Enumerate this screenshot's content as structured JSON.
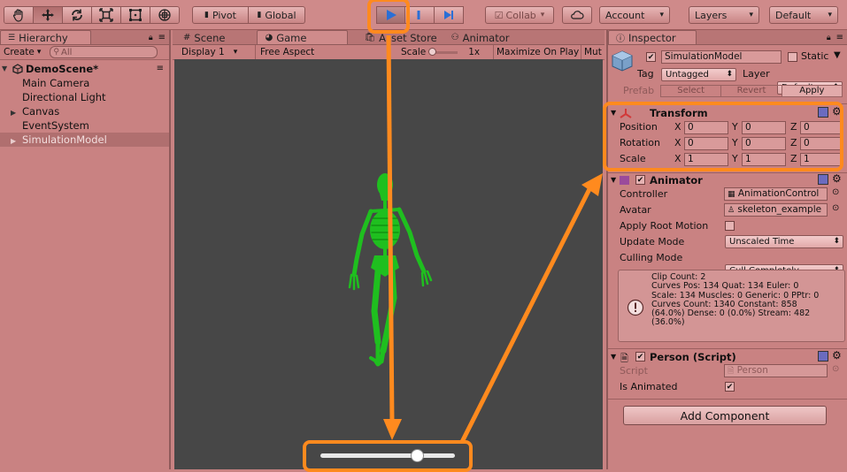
{
  "toolbar": {
    "pivot_label": "Pivot",
    "global_label": "Global",
    "collab_label": "Collab",
    "account_label": "Account",
    "layers_label": "Layers",
    "layout_label": "Default"
  },
  "hierarchy": {
    "tab_label": "Hierarchy",
    "create_label": "Create",
    "search_placeholder": "All",
    "scene_name": "DemoScene*",
    "items": [
      {
        "label": "Main Camera"
      },
      {
        "label": "Directional Light"
      },
      {
        "label": "Canvas"
      },
      {
        "label": "EventSystem"
      },
      {
        "label": "SimulationModel"
      }
    ]
  },
  "center": {
    "tabs": [
      {
        "label": "Scene"
      },
      {
        "label": "Game"
      },
      {
        "label": "Asset Store"
      },
      {
        "label": "Animator"
      }
    ],
    "display_label": "Display 1",
    "aspect_label": "Free Aspect",
    "scale_label": "Scale",
    "scale_value": "1x",
    "maximize_label": "Maximize On Play",
    "mute_label": "Mut",
    "slider_value": 0.72
  },
  "inspector": {
    "tab_label": "Inspector",
    "object_name": "SimulationModel",
    "static_label": "Static",
    "tag_label": "Tag",
    "tag_value": "Untagged",
    "layer_label": "Layer",
    "layer_value": "Default",
    "prefab_label": "Prefab",
    "select_label": "Select",
    "revert_label": "Revert",
    "apply_label": "Apply",
    "transform": {
      "title": "Transform",
      "position_label": "Position",
      "rotation_label": "Rotation",
      "scale_label": "Scale",
      "x": "X",
      "y": "Y",
      "z": "Z",
      "position": [
        "0",
        "0",
        "0"
      ],
      "rotation": [
        "0",
        "0",
        "0"
      ],
      "scale": [
        "1",
        "1",
        "1"
      ]
    },
    "animator": {
      "title": "Animator",
      "controller_label": "Controller",
      "controller_value": "AnimationControl",
      "avatar_label": "Avatar",
      "avatar_value": "skeleton_example",
      "apply_root_motion_label": "Apply Root Motion",
      "update_mode_label": "Update Mode",
      "update_mode_value": "Unscaled Time",
      "culling_mode_label": "Culling Mode",
      "culling_mode_value": "Cull Completely",
      "info_lines": [
        "Clip Count: 2",
        "Curves Pos: 134 Quat: 134 Euler: 0",
        "Scale: 134 Muscles: 0 Generic: 0 PPtr: 0",
        "Curves Count: 1340 Constant: 858",
        "(64.0%) Dense: 0 (0.0%) Stream: 482",
        "(36.0%)"
      ]
    },
    "person": {
      "title": "Person (Script)",
      "script_label": "Script",
      "script_value": "Person",
      "is_animated_label": "Is Animated"
    },
    "add_component_label": "Add Component"
  },
  "colors": {
    "accent_orange": "#ff8a1e",
    "skeleton_green": "#1fbf1f",
    "play_blue": "#2a6fd6"
  }
}
